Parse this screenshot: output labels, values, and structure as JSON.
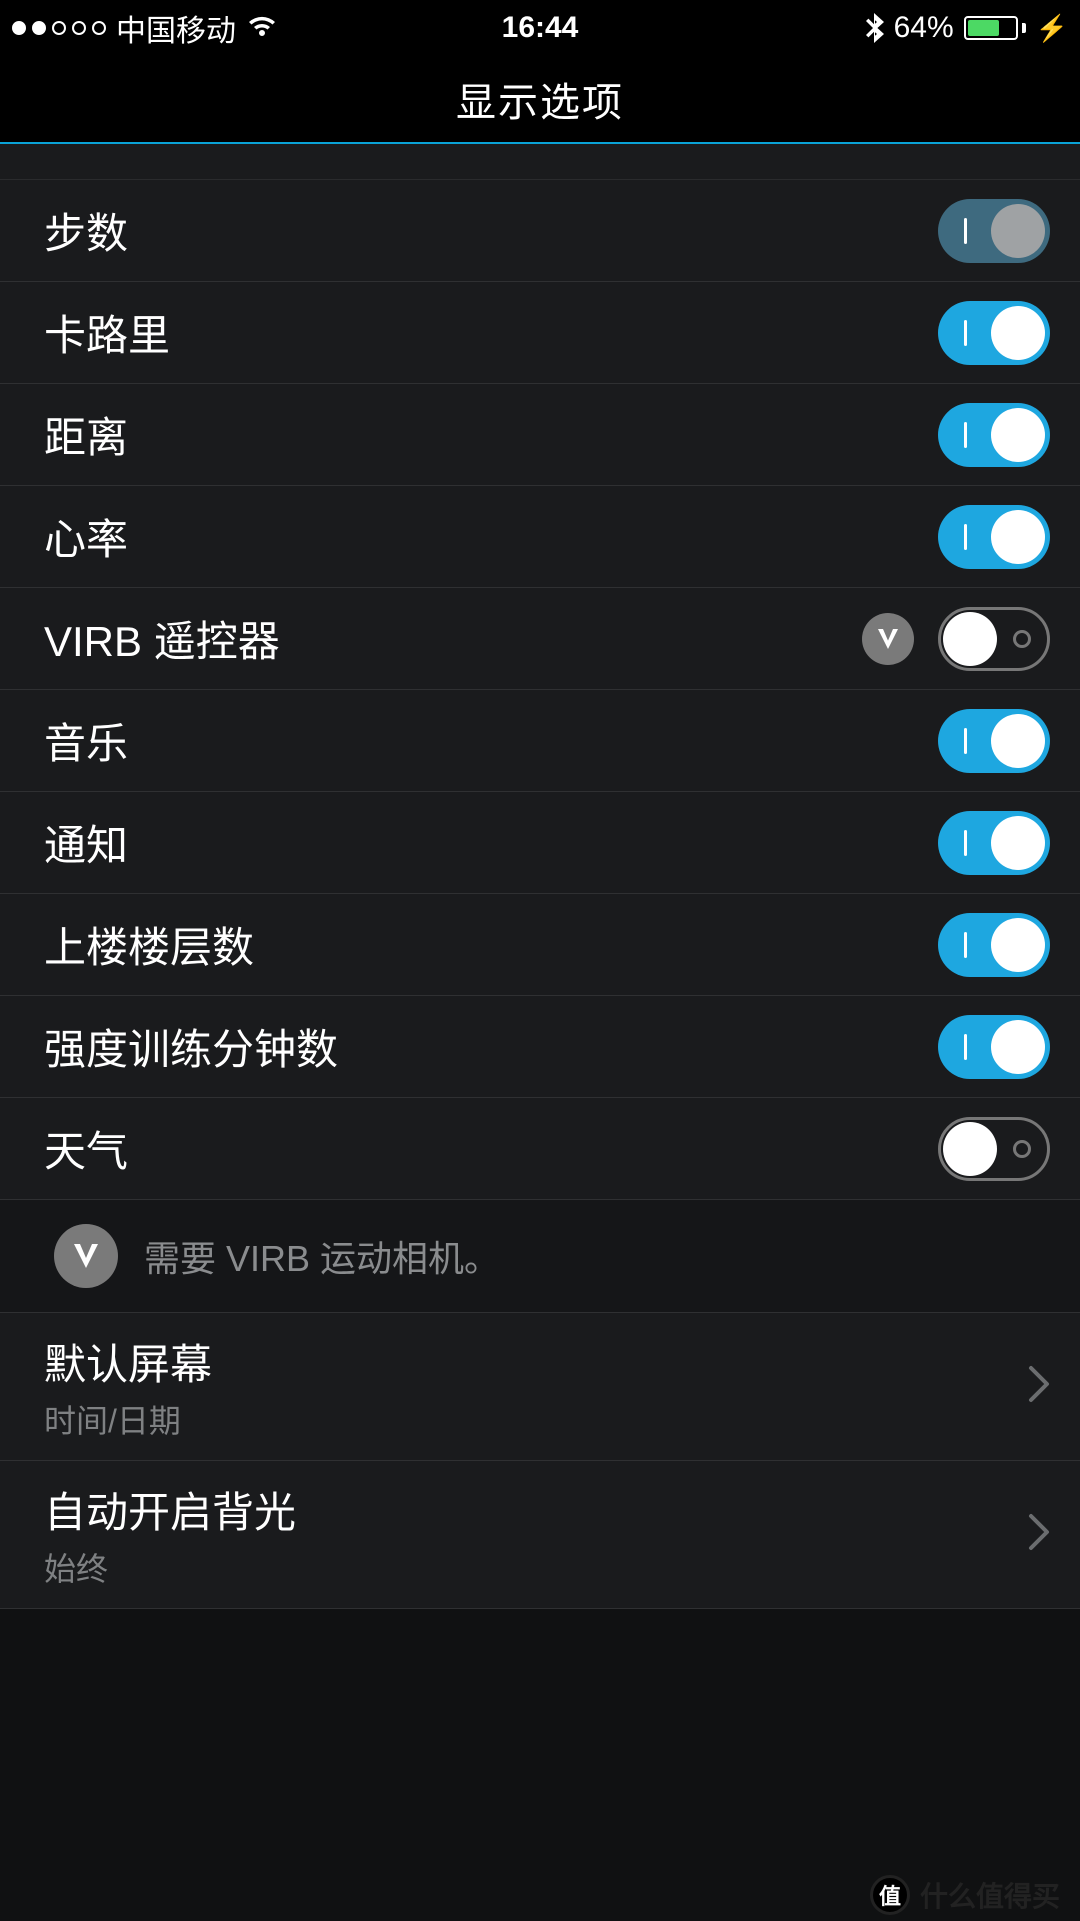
{
  "status": {
    "carrier": "中国移动",
    "time": "16:44",
    "battery_pct": "64%"
  },
  "header": {
    "title": "显示选项"
  },
  "options": [
    {
      "label": "步数",
      "state": "dim",
      "badge": false
    },
    {
      "label": "卡路里",
      "state": "on",
      "badge": false
    },
    {
      "label": "距离",
      "state": "on",
      "badge": false
    },
    {
      "label": "心率",
      "state": "on",
      "badge": false
    },
    {
      "label": "VIRB 遥控器",
      "state": "off",
      "badge": true
    },
    {
      "label": "音乐",
      "state": "on",
      "badge": false
    },
    {
      "label": "通知",
      "state": "on",
      "badge": false
    },
    {
      "label": "上楼楼层数",
      "state": "on",
      "badge": false
    },
    {
      "label": "强度训练分钟数",
      "state": "on",
      "badge": false
    },
    {
      "label": "天气",
      "state": "off",
      "badge": false
    }
  ],
  "note": {
    "text": "需要 VIRB 运动相机。"
  },
  "nav_items": [
    {
      "title": "默认屏幕",
      "subtitle": "时间/日期"
    },
    {
      "title": "自动开启背光",
      "subtitle": "始终"
    }
  ],
  "watermark": {
    "badge": "值",
    "text": "什么值得买"
  },
  "colors": {
    "accent": "#1ea7e0",
    "divider": "#0aa3d6"
  }
}
